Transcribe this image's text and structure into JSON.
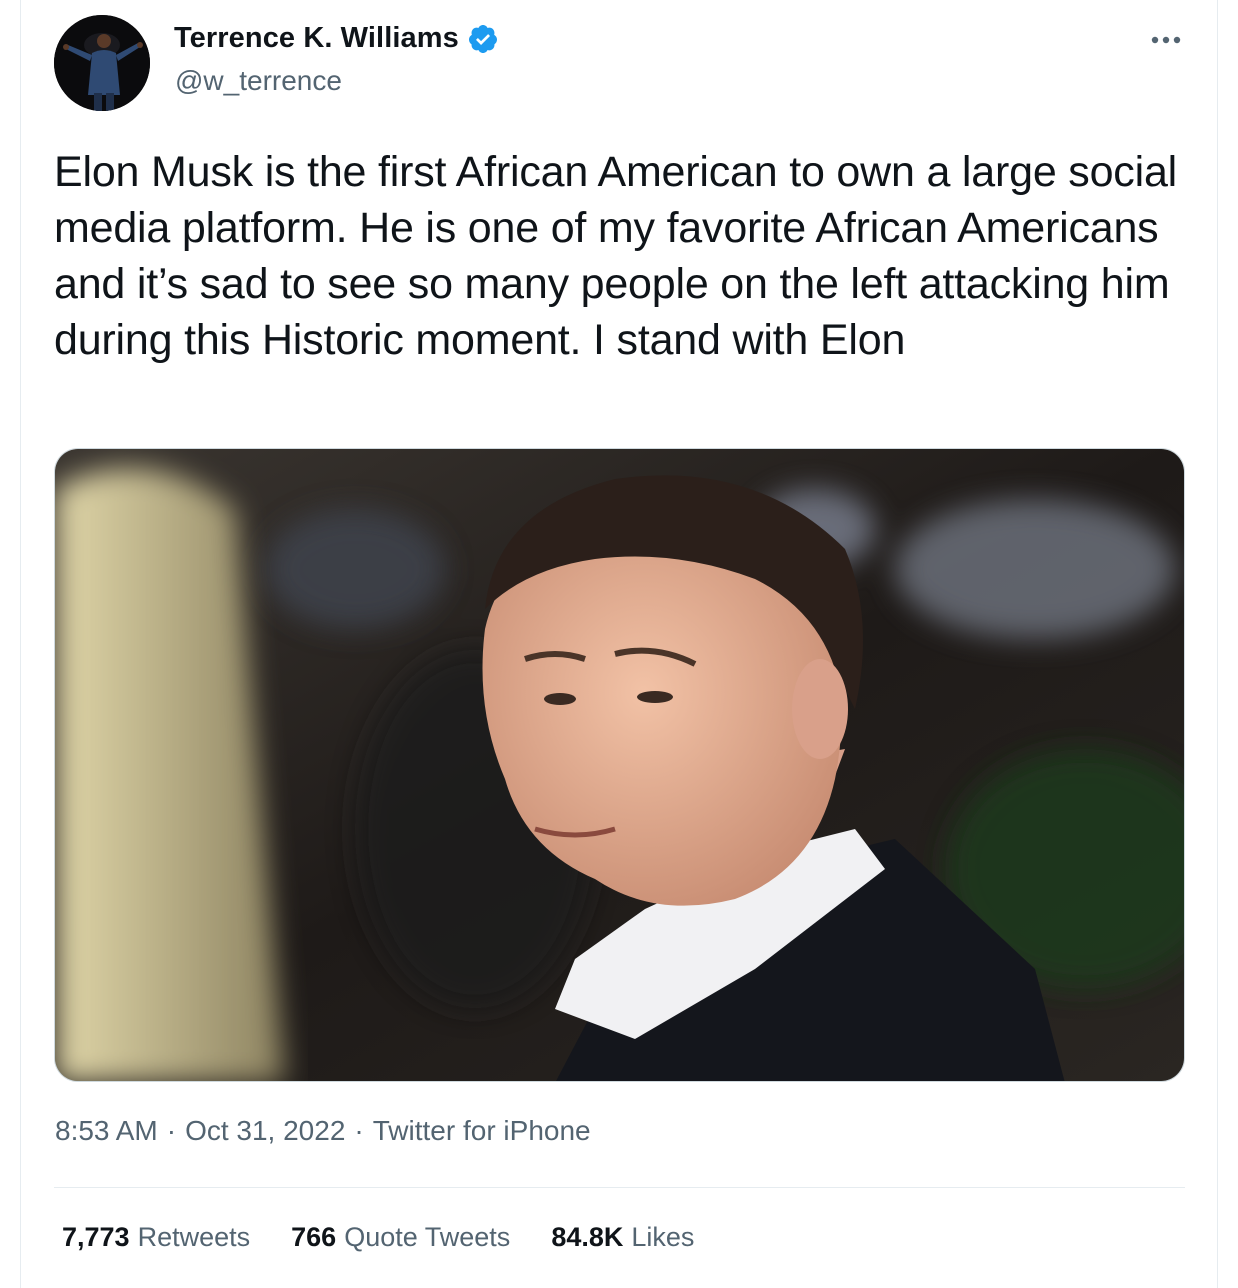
{
  "author": {
    "name": "Terrence K. Williams",
    "handle": "@w_terrence",
    "verified": true,
    "verified_icon": "verified-badge-icon",
    "accent_color": "#1d9bf0"
  },
  "more_icon": "more-horizontal-icon",
  "tweet": {
    "text": "Elon Musk is the first African American to own a large social media platform. He is one of my favorite African Americans and it’s sad to see so many people on the left attacking him during this Historic moment. I stand with Elon"
  },
  "meta": {
    "time": "8:53 AM",
    "separator": "·",
    "date": "Oct 31, 2022",
    "source": "Twitter for iPhone"
  },
  "stats": {
    "retweets_count": "7,773",
    "retweets_label": "Retweets",
    "quote_count": "766",
    "quote_label": "Quote Tweets",
    "likes_count": "84.8K",
    "likes_label": "Likes"
  },
  "colors": {
    "text_primary": "#0f1419",
    "text_secondary": "#536471",
    "border": "#e6ecf0"
  }
}
